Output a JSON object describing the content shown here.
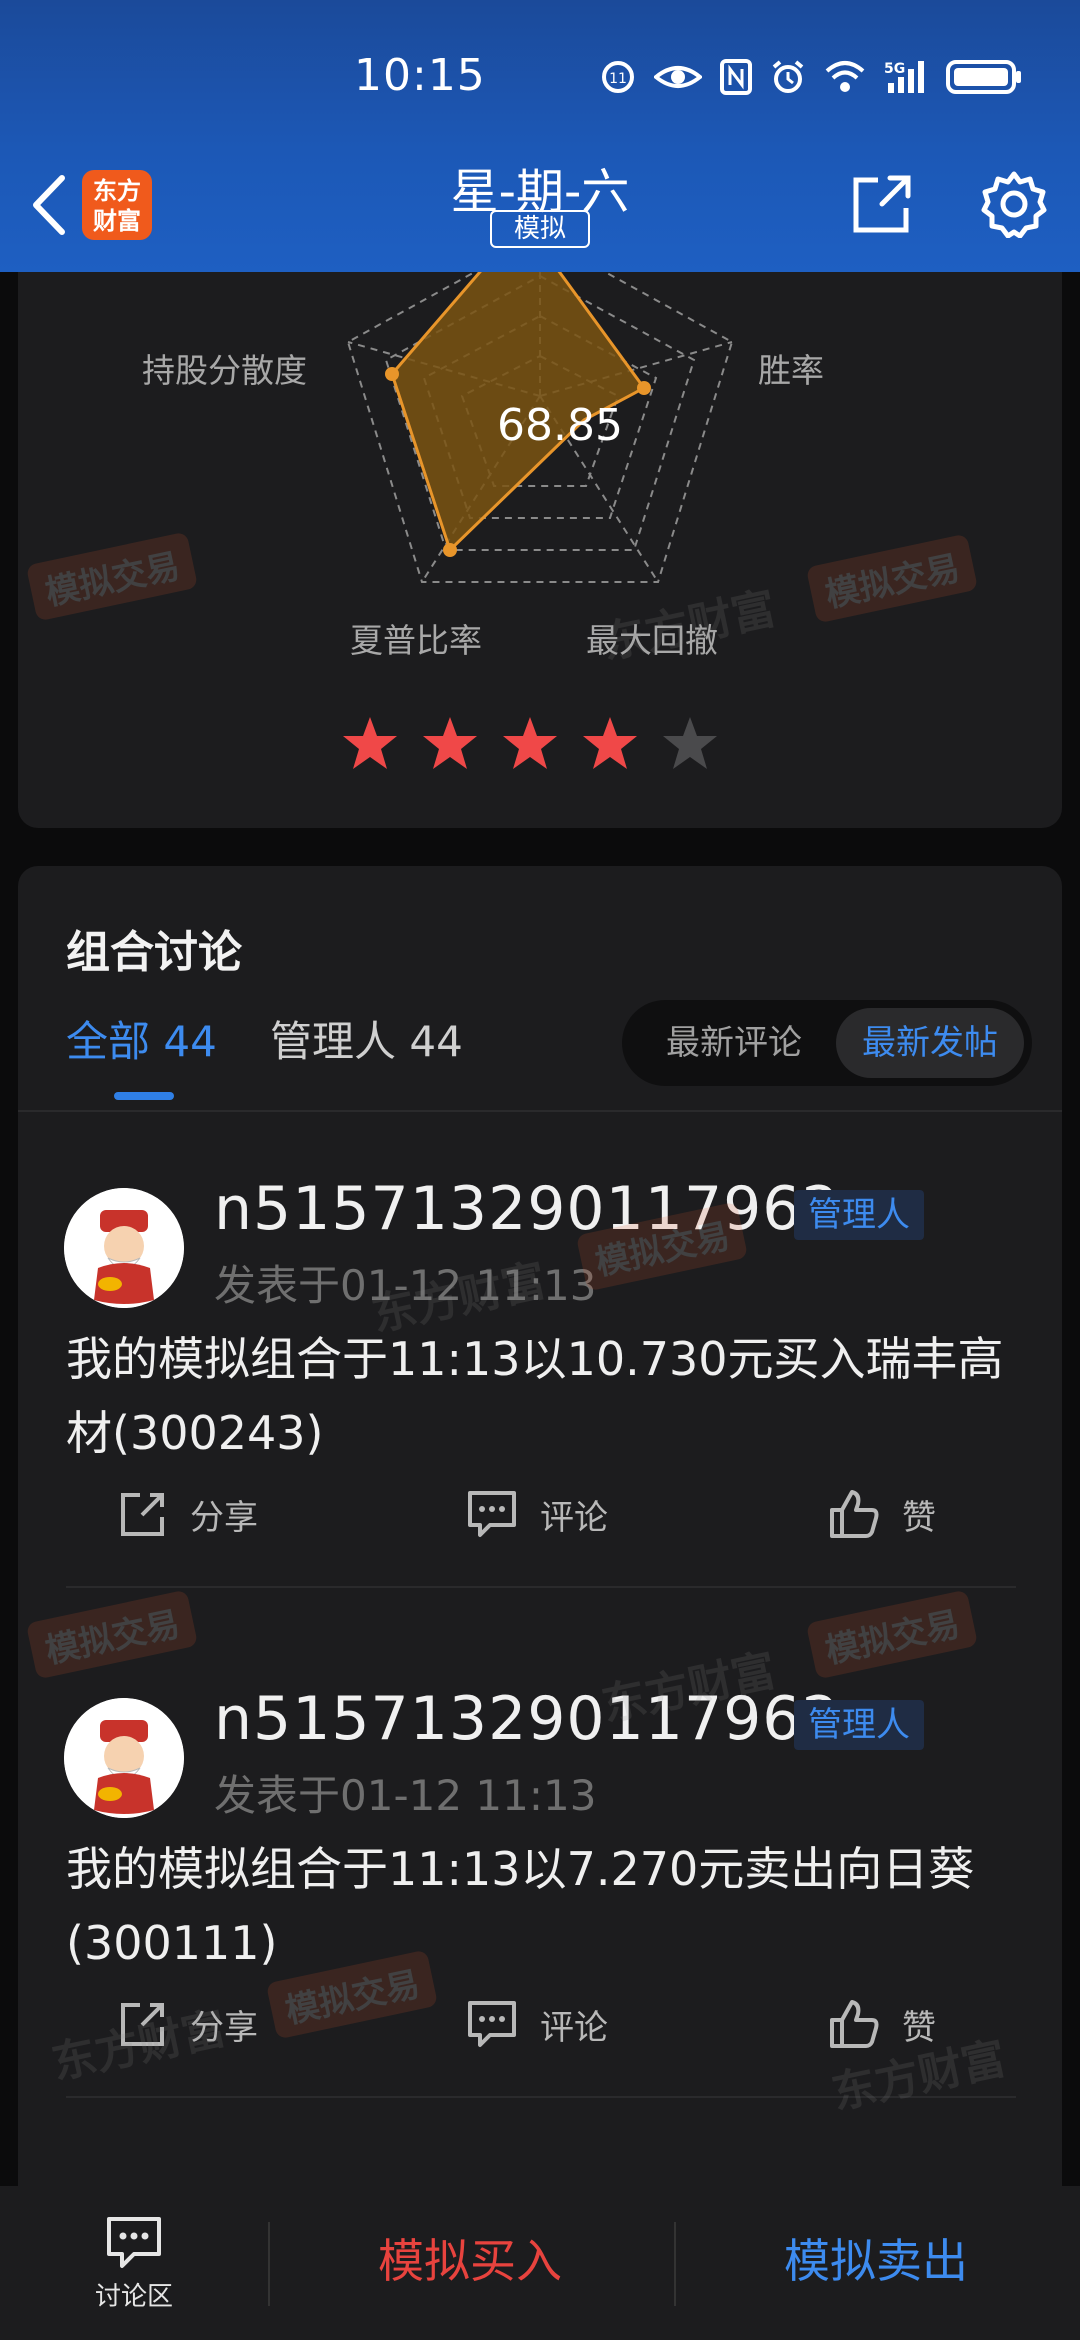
{
  "status_bar": {
    "time": "10:15",
    "network": "5G"
  },
  "nav": {
    "logo_text": "东方\n财富",
    "title": "星-期-六",
    "mode_tag": "模拟"
  },
  "radar": {
    "score": "68.85",
    "axes": [
      "持股分散度",
      "胜率",
      "最大回撤",
      "夏普比率"
    ],
    "rating": {
      "filled": 4,
      "total": 5
    }
  },
  "discussion": {
    "title": "组合讨论",
    "tabs": [
      {
        "label": "全部",
        "count": "44"
      },
      {
        "label": "管理人",
        "count": "44"
      }
    ],
    "sort_options": [
      "最新评论",
      "最新发帖"
    ],
    "posts": [
      {
        "username": "n515713290117962",
        "role": "管理人",
        "time": "发表于01-12 11:13",
        "content": "我的模拟组合于11:13以10.730元买入瑞丰高材(300243)",
        "actions": {
          "share": "分享",
          "comment": "评论",
          "like": "赞"
        }
      },
      {
        "username": "n515713290117962",
        "role": "管理人",
        "time": "发表于01-12 11:13",
        "content": "我的模拟组合于11:13以7.270元卖出向日葵(300111)",
        "actions": {
          "share": "分享",
          "comment": "评论",
          "like": "赞"
        }
      }
    ]
  },
  "bottom_bar": {
    "forum_label": "讨论区",
    "buy_label": "模拟买入",
    "sell_label": "模拟卖出"
  },
  "watermarks": {
    "badge": "模拟交易",
    "text": "东方财富"
  },
  "colors": {
    "header_blue": "#1c58b6",
    "accent_blue": "#3d8bef",
    "buy_red": "#e8433e",
    "star_red": "#f04848",
    "radar_fill": "#7a5412",
    "radar_stroke": "#e8952a"
  }
}
